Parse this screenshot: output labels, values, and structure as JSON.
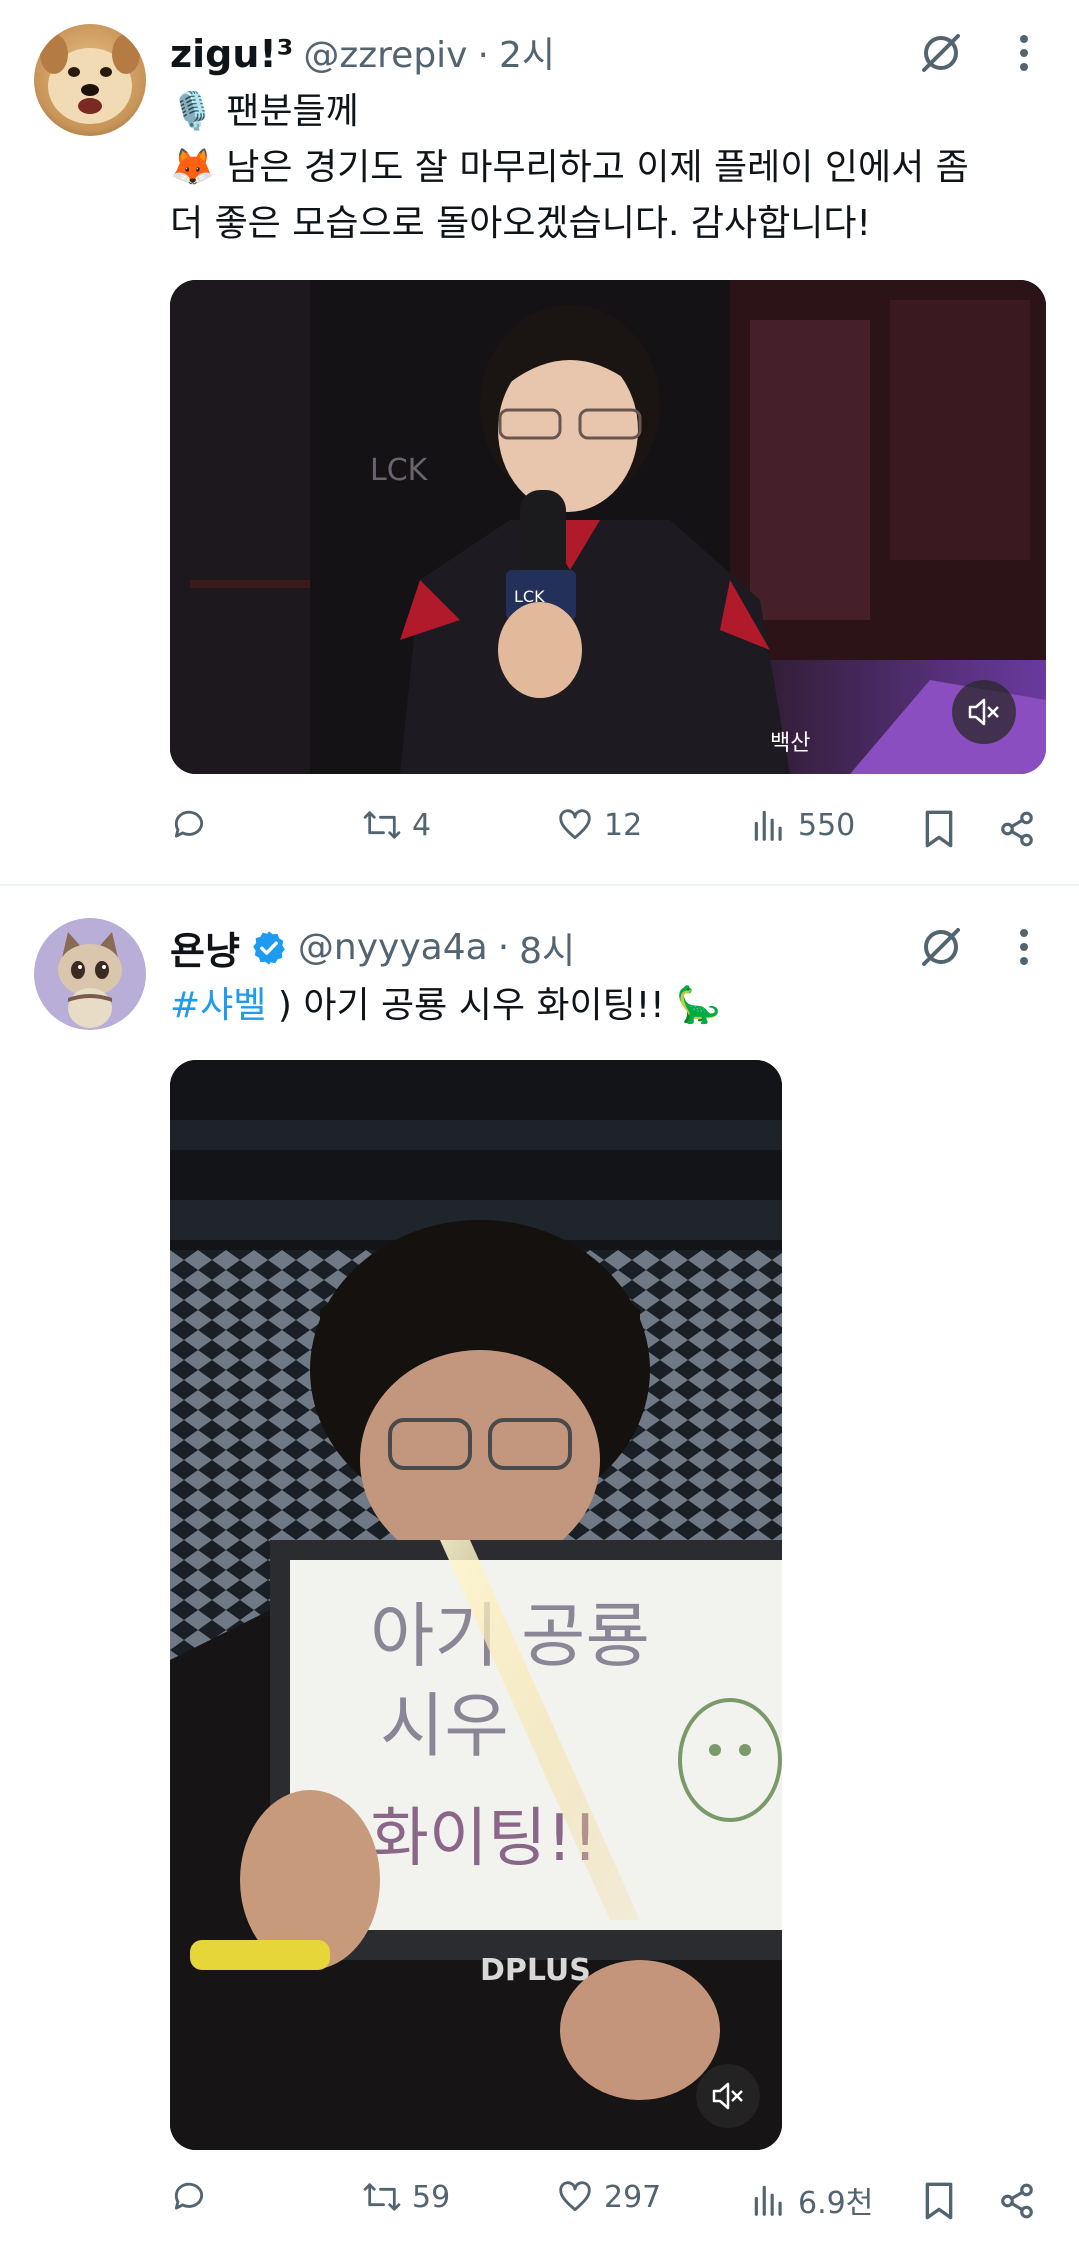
{
  "tweets": [
    {
      "name": "zigu!³",
      "handle": "@zzrepiv",
      "sep": "·",
      "time": "2시",
      "line1": "🎙️ 팬분들께",
      "line2": "🦊 남은 경기도 잘 마무리하고 이제 플레이 인에서 좀",
      "line3": "더 좋은 모습으로 돌아오겠습니다. 감사합니다!",
      "replies": "",
      "retweets": "4",
      "likes": "12",
      "views": "550"
    },
    {
      "name": "욘냥",
      "handle": "@nyyya4a",
      "sep": "·",
      "time": "8시",
      "hashtag": "#샤벨",
      "text": " ) 아기 공룡 시우 화이팅!! 🦕",
      "replies": "",
      "retweets": "59",
      "likes": "297",
      "views": "6.9천"
    }
  ],
  "media": {
    "video1_overlay": "LCK",
    "video1_jacket": "백산",
    "video2_sign_line1": "아기 공룡",
    "video2_sign_line2": "시우",
    "video2_sign_line3": "화이팅!!",
    "video2_board_brand": "DPLUS"
  },
  "colors": {
    "accent": "#1d9bf0",
    "muted": "#536471",
    "verified": "#1d9bf0"
  },
  "icons": [
    "grok-icon",
    "more-icon",
    "reply-icon",
    "retweet-icon",
    "like-icon",
    "views-icon",
    "bookmark-icon",
    "share-icon",
    "mute-icon",
    "verified-icon"
  ]
}
